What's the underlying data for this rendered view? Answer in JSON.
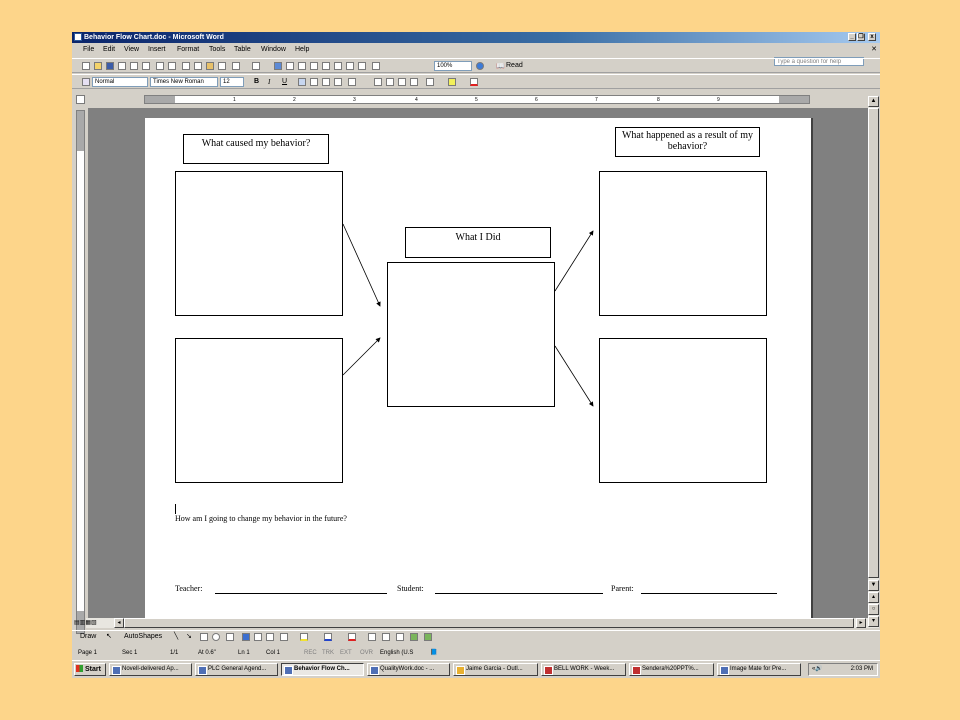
{
  "window": {
    "title": "Behavior Flow Chart.doc - Microsoft Word",
    "minimize": "_",
    "restore": "❐",
    "close": "x"
  },
  "menu": {
    "items": [
      "File",
      "Edit",
      "View",
      "Insert",
      "Format",
      "Tools",
      "Table",
      "Window",
      "Help"
    ],
    "ask": "Type a question for help"
  },
  "toolbar": {
    "zoom": "100%",
    "read": "Read"
  },
  "format": {
    "style": "Normal",
    "font": "Times New Roman",
    "size": "12",
    "bold": "B",
    "italic": "I",
    "underline": "U"
  },
  "ruler": {
    "numbers": [
      "1",
      "2",
      "3",
      "4",
      "5",
      "6",
      "7",
      "8",
      "9"
    ]
  },
  "document": {
    "cause_label": "What caused my behavior?",
    "did_label": "What I Did",
    "result_label": "What happened as a result of my behavior?",
    "change_question": "How am I going to change my behavior in the future?",
    "teacher": "Teacher:",
    "student": "Student:",
    "parent": "Parent:"
  },
  "drawbar": {
    "draw": "Draw",
    "autoshapes": "AutoShapes"
  },
  "status": {
    "page": "Page 1",
    "sec": "Sec 1",
    "pages": "1/1",
    "at": "At 0.6\"",
    "ln": "Ln 1",
    "col": "Col 1",
    "rec": "REC",
    "trk": "TRK",
    "ext": "EXT",
    "ovr": "OVR",
    "lang": "English (U.S"
  },
  "taskbar": {
    "start": "Start",
    "tasks": [
      "Novell-delivered Ap...",
      "PLC General Agend...",
      "Behavior Flow Ch...",
      "QualityWork.doc - ...",
      "Jaime Garcia - Outl...",
      "BELL WORK - Week...",
      "Sendera%20PPT%...",
      "Image Mate for Pre..."
    ],
    "time": "2:03 PM"
  },
  "colors": {
    "background": "#FDD58A",
    "titlebar": "#0A246A",
    "chrome": "#D4D0C8"
  }
}
